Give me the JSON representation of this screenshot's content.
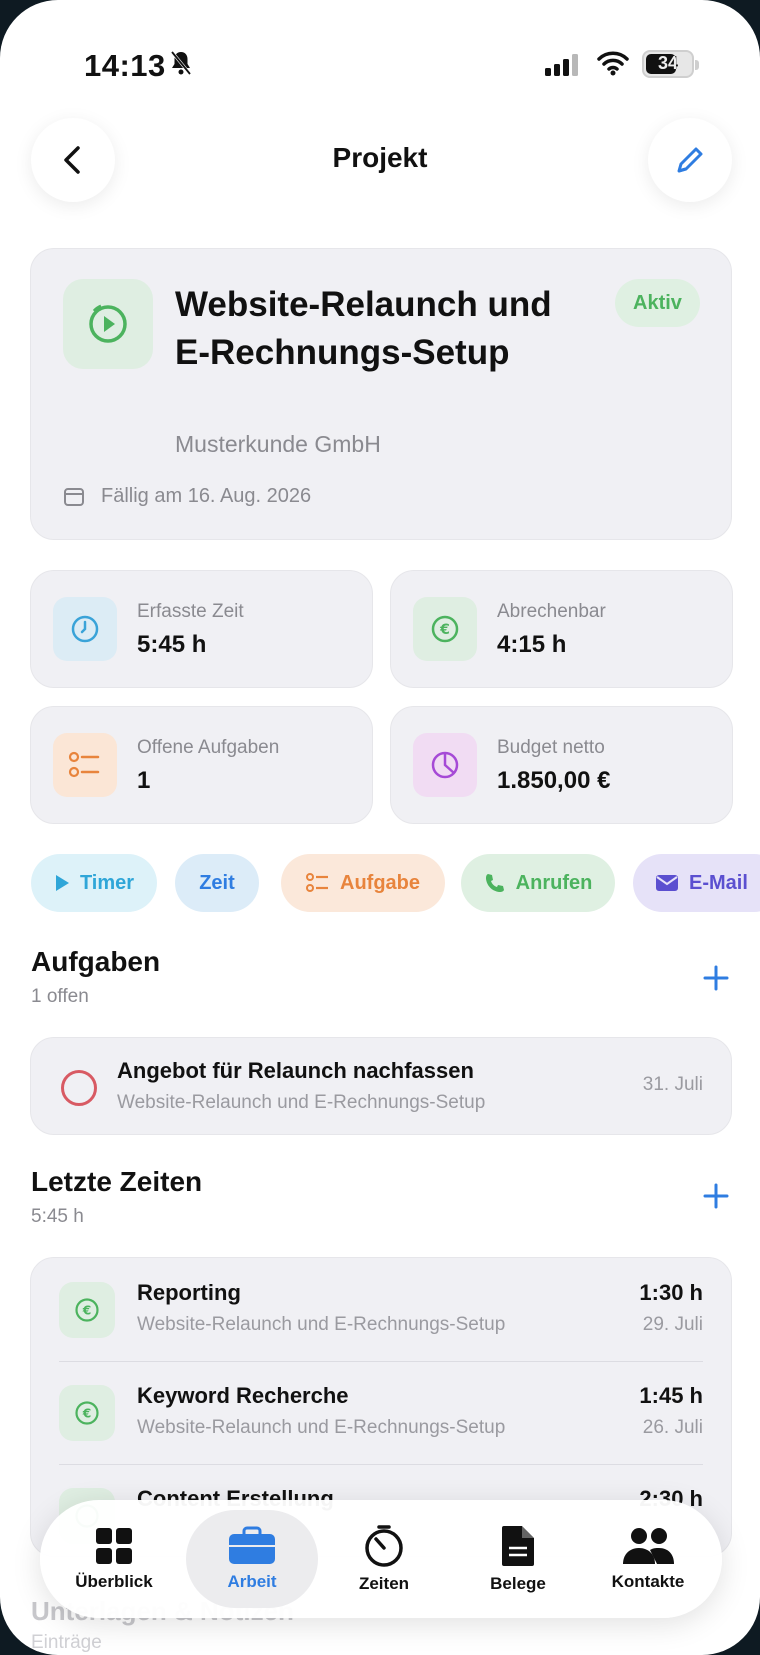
{
  "status": {
    "time": "14:13",
    "battery": "34"
  },
  "header": {
    "title": "Projekt"
  },
  "project": {
    "name": "Website-Relaunch und E-Rechnungs-Setup",
    "client": "Musterkunde GmbH",
    "due": "Fällig am 16. Aug. 2026",
    "status": "Aktiv"
  },
  "stats": [
    {
      "label": "Erfasste Zeit",
      "value": "5:45 h",
      "icon": "clock-icon"
    },
    {
      "label": "Abrechenbar",
      "value": "4:15 h",
      "icon": "euro-icon"
    },
    {
      "label": "Offene Aufgaben",
      "value": "1",
      "icon": "checklist-icon"
    },
    {
      "label": "Budget netto",
      "value": "1.850,00 €",
      "icon": "pie-chart-icon"
    }
  ],
  "chips": [
    {
      "label": "Timer",
      "icon": "play-icon"
    },
    {
      "label": "Zeit"
    },
    {
      "label": "Aufgabe",
      "icon": "checklist-icon"
    },
    {
      "label": "Anrufen",
      "icon": "phone-icon"
    },
    {
      "label": "E-Mail",
      "icon": "mail-icon"
    }
  ],
  "tasks_section": {
    "title": "Aufgaben",
    "subtitle": "1 offen",
    "items": [
      {
        "title": "Angebot für Relaunch nachfassen",
        "project": "Website-Relaunch und E-Rechnungs-Setup",
        "date": "31. Juli"
      }
    ]
  },
  "times_section": {
    "title": "Letzte Zeiten",
    "subtitle": "5:45 h",
    "items": [
      {
        "title": "Reporting",
        "project": "Website-Relaunch und E-Rechnungs-Setup",
        "duration": "1:30 h",
        "date": "29. Juli"
      },
      {
        "title": "Keyword Recherche",
        "project": "Website-Relaunch und E-Rechnungs-Setup",
        "duration": "1:45 h",
        "date": "26. Juli"
      },
      {
        "title": "Content Erstellung",
        "project": "",
        "duration": "2:30 h",
        "date": ""
      }
    ]
  },
  "next_section": {
    "title": "Unterlagen & Notizen",
    "subtitle": "Einträge"
  },
  "tabbar": [
    {
      "label": "Überblick",
      "icon": "grid-icon"
    },
    {
      "label": "Arbeit",
      "icon": "briefcase-icon",
      "active": true
    },
    {
      "label": "Zeiten",
      "icon": "stopwatch-icon"
    },
    {
      "label": "Belege",
      "icon": "document-icon"
    },
    {
      "label": "Kontakte",
      "icon": "people-icon"
    }
  ],
  "colors": {
    "accent": "#2f7de1",
    "green": "#4cb35e",
    "orange": "#e8843c",
    "purple": "#a64ad6",
    "red": "#d85a63"
  }
}
